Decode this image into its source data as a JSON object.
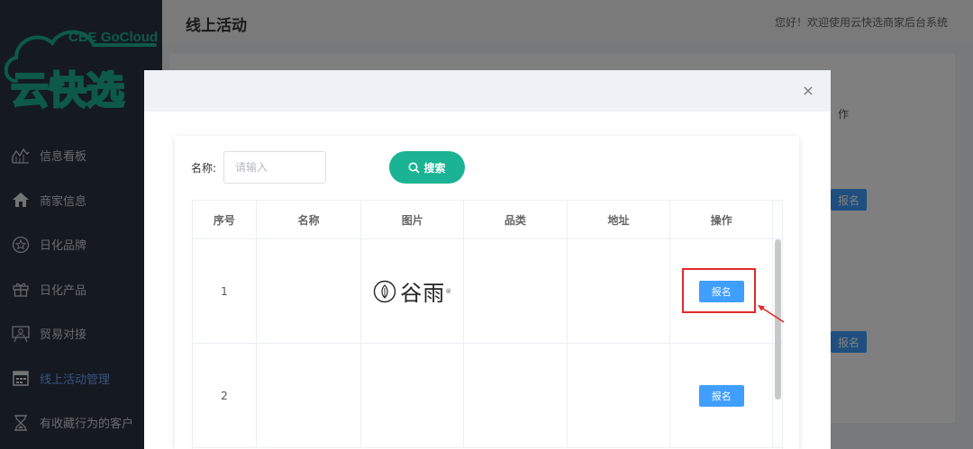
{
  "sidebar": {
    "brand_en": "CBE GoCloud",
    "brand_cn": "云快选",
    "items": [
      {
        "label": "信息看板",
        "icon": "chart-line-icon"
      },
      {
        "label": "商家信息",
        "icon": "home-icon"
      },
      {
        "label": "日化品牌",
        "icon": "star-circle-icon"
      },
      {
        "label": "日化产品",
        "icon": "gift-icon"
      },
      {
        "label": "贸易对接",
        "icon": "presentation-icon"
      },
      {
        "label": "线上活动管理",
        "icon": "calendar-icon"
      },
      {
        "label": "有收藏行为的客户",
        "icon": "hourglass-icon"
      }
    ],
    "active_index": 5
  },
  "header": {
    "title": "线上活动",
    "welcome": "您好！欢迎使用云快选商家后台系统"
  },
  "background": {
    "column_fragment": "作",
    "button_fragment_1": "报名",
    "button_fragment_2": "报名"
  },
  "dialog": {
    "close_symbol": "×",
    "search": {
      "label": "名称:",
      "placeholder": "请输入",
      "button_label": "搜索"
    },
    "table": {
      "columns": [
        "序号",
        "名称",
        "图片",
        "品类",
        "地址",
        "操作"
      ],
      "rows": [
        {
          "index": "1",
          "name": "",
          "image_text": "谷雨",
          "category": "",
          "address": "",
          "action": "报名"
        },
        {
          "index": "2",
          "name": "",
          "image_text": "",
          "category": "",
          "address": "",
          "action": "报名"
        }
      ]
    }
  },
  "colors": {
    "sidebar_bg": "#2b3541",
    "brand_green": "#1ab394",
    "primary_blue": "#409eff",
    "highlight_red": "#e02a2a"
  }
}
